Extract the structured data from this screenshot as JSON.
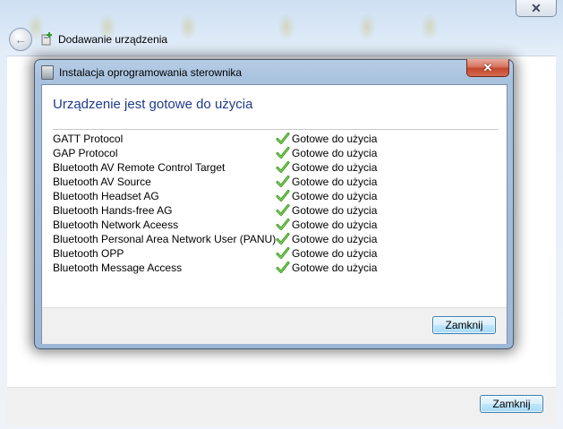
{
  "background_window": {
    "title": "Dodawanie urządzenia",
    "close_label": "Zamknij",
    "close_glyph": "✕"
  },
  "dialog": {
    "title": "Instalacja oprogramowania sterownika",
    "close_glyph": "✕",
    "heading": "Urządzenie jest gotowe do użycia",
    "items": [
      {
        "name": "GATT Protocol",
        "status": "Gotowe do użycia"
      },
      {
        "name": "GAP Protocol",
        "status": "Gotowe do użycia"
      },
      {
        "name": "Bluetooth AV Remote Control Target",
        "status": "Gotowe do użycia"
      },
      {
        "name": "Bluetooth AV Source",
        "status": "Gotowe do użycia"
      },
      {
        "name": "Bluetooth Headset AG",
        "status": "Gotowe do użycia"
      },
      {
        "name": "Bluetooth Hands-free AG",
        "status": "Gotowe do użycia"
      },
      {
        "name": "Bluetooth Network Aceess",
        "status": "Gotowe do użycia"
      },
      {
        "name": "Bluetooth Personal Area Network User (PANU)",
        "status": "Gotowe do użycia"
      },
      {
        "name": "Bluetooth OPP",
        "status": "Gotowe do użycia"
      },
      {
        "name": "Bluetooth Message Access",
        "status": "Gotowe do użycia"
      }
    ],
    "close_label": "Zamknij"
  },
  "icons": {
    "status": "green-check-icon",
    "back": "back-arrow-icon",
    "wizard": "add-device-icon",
    "driver": "driver-install-icon"
  },
  "colors": {
    "heading": "#1e3a8a",
    "check": "#3c9a1e",
    "close_button": "#c4462c"
  }
}
